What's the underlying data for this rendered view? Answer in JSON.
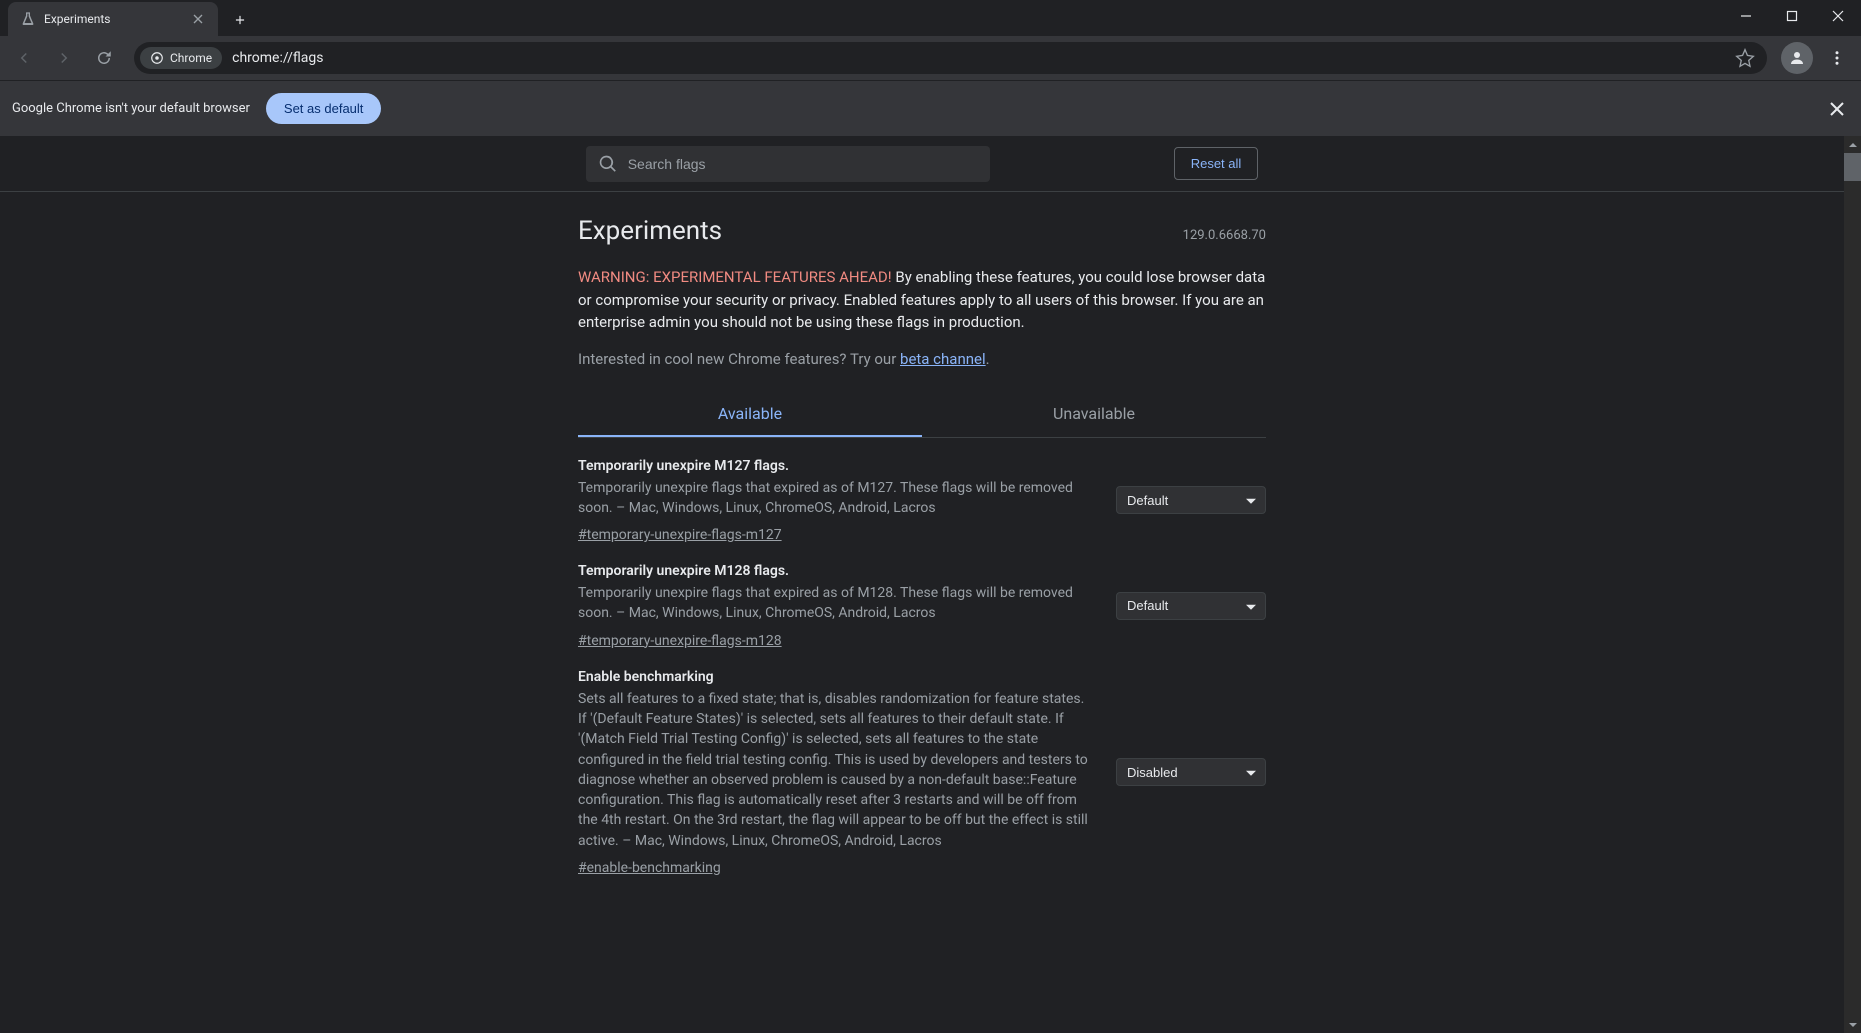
{
  "browser": {
    "tab_title": "Experiments",
    "omnibox_chip": "Chrome",
    "url": "chrome://flags"
  },
  "infobar": {
    "text": "Google Chrome isn't your default browser",
    "button": "Set as default"
  },
  "search": {
    "placeholder": "Search flags"
  },
  "reset_label": "Reset all",
  "header": {
    "title": "Experiments",
    "version": "129.0.6668.70",
    "warning_label": "WARNING: EXPERIMENTAL FEATURES AHEAD!",
    "warning_text": " By enabling these features, you could lose browser data or compromise your security or privacy. Enabled features apply to all users of this browser. If you are an enterprise admin you should not be using these flags in production.",
    "beta_prefix": "Interested in cool new Chrome features? Try our ",
    "beta_link": "beta channel",
    "beta_suffix": "."
  },
  "tabs": {
    "available": "Available",
    "unavailable": "Unavailable"
  },
  "flags": [
    {
      "title": "Temporarily unexpire M127 flags.",
      "desc": "Temporarily unexpire flags that expired as of M127. These flags will be removed soon. – Mac, Windows, Linux, ChromeOS, Android, Lacros",
      "anchor": "#temporary-unexpire-flags-m127",
      "value": "Default"
    },
    {
      "title": "Temporarily unexpire M128 flags.",
      "desc": "Temporarily unexpire flags that expired as of M128. These flags will be removed soon. – Mac, Windows, Linux, ChromeOS, Android, Lacros",
      "anchor": "#temporary-unexpire-flags-m128",
      "value": "Default"
    },
    {
      "title": "Enable benchmarking",
      "desc": "Sets all features to a fixed state; that is, disables randomization for feature states. If '(Default Feature States)' is selected, sets all features to their default state. If '(Match Field Trial Testing Config)' is selected, sets all features to the state configured in the field trial testing config. This is used by developers and testers to diagnose whether an observed problem is caused by a non-default base::Feature configuration. This flag is automatically reset after 3 restarts and will be off from the 4th restart. On the 3rd restart, the flag will appear to be off but the effect is still active. – Mac, Windows, Linux, ChromeOS, Android, Lacros",
      "anchor": "#enable-benchmarking",
      "value": "Disabled"
    }
  ]
}
